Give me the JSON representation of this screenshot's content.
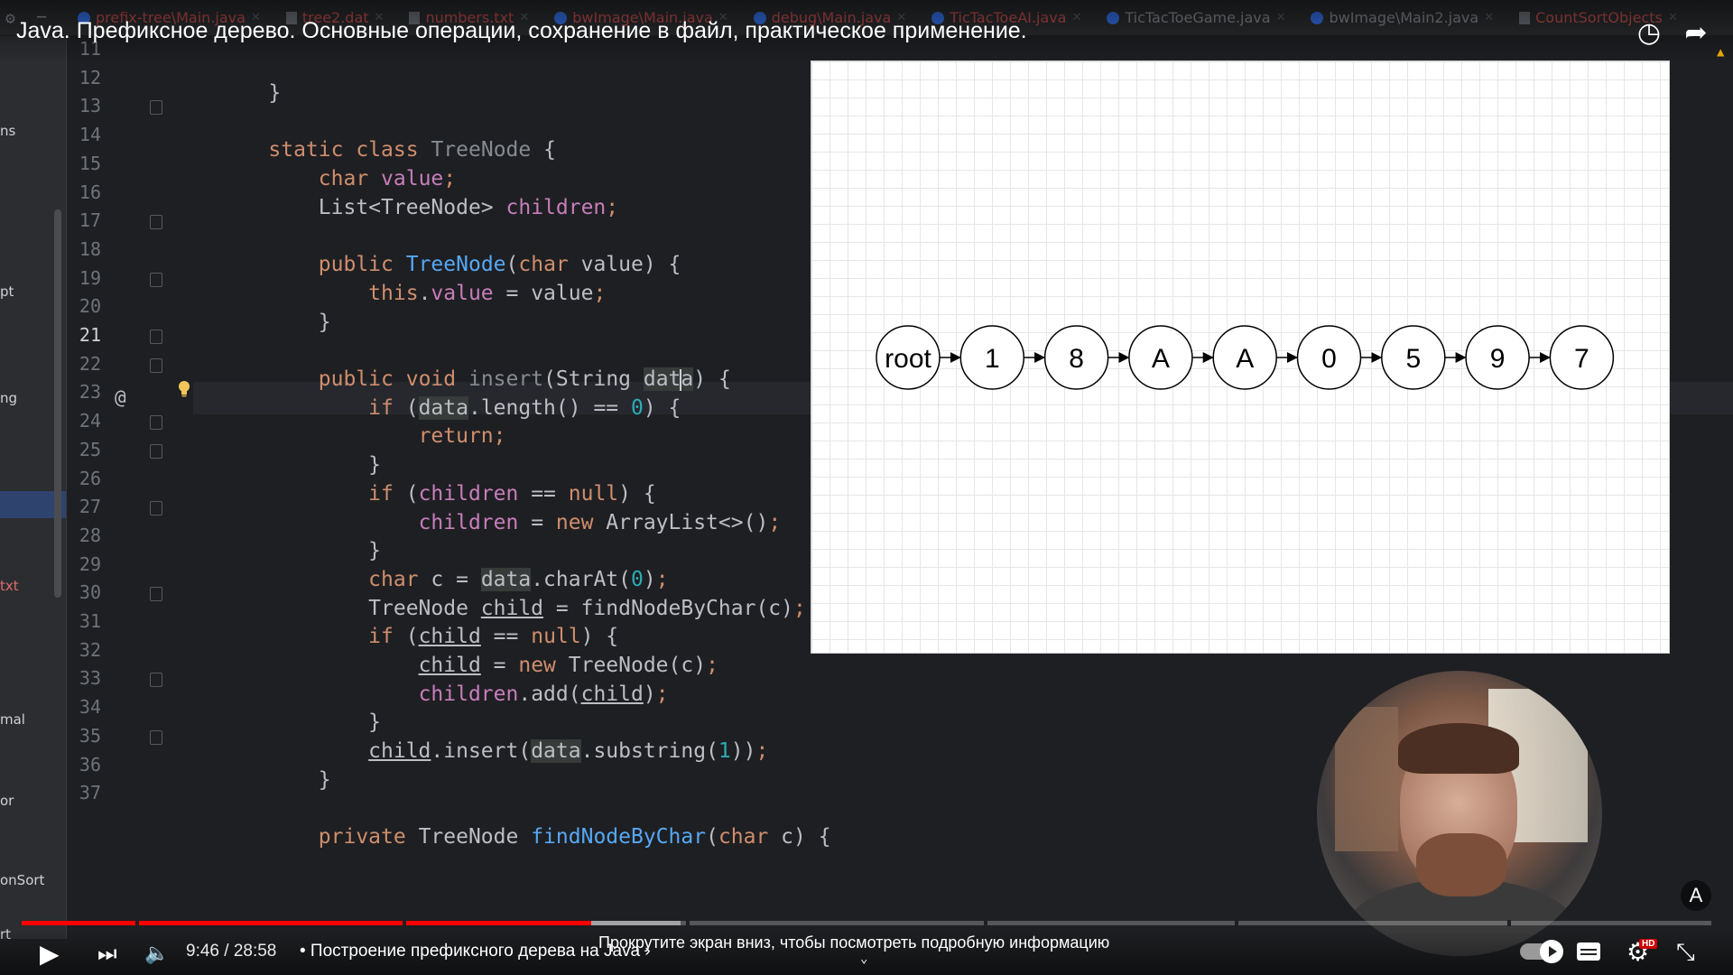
{
  "ide": {
    "tabs": [
      {
        "label": "prefix-tree\\Main.java",
        "kind": "java",
        "color": "red"
      },
      {
        "label": "tree2.dat",
        "kind": "file",
        "color": "red"
      },
      {
        "label": "numbers.txt",
        "kind": "file",
        "color": "red"
      },
      {
        "label": "bwImage\\Main.java",
        "kind": "java",
        "color": "red"
      },
      {
        "label": "debug\\Main.java",
        "kind": "java",
        "color": "red"
      },
      {
        "label": "TicTacToeAI.java",
        "kind": "java",
        "color": "red"
      },
      {
        "label": "TicTacToeGame.java",
        "kind": "java",
        "color": "normal"
      },
      {
        "label": "bwImage\\Main2.java",
        "kind": "java",
        "color": "normal"
      },
      {
        "label": "CountSortObjects",
        "kind": "file",
        "color": "red"
      }
    ],
    "project_fragments": [
      "ns",
      "pt",
      "ng",
      "txt",
      "mal",
      "or",
      "onSort",
      "rt"
    ],
    "line_numbers": [
      "11",
      "12",
      "13",
      "14",
      "15",
      "16",
      "17",
      "18",
      "19",
      "20",
      "21",
      "22",
      "23",
      "24",
      "25",
      "26",
      "27",
      "28",
      "29",
      "30",
      "31",
      "32",
      "33",
      "34",
      "35",
      "36",
      "37"
    ],
    "current_line": "21",
    "code_lines": [
      "    }",
      "",
      "    static class TreeNode {",
      "        char value;",
      "        List<TreeNode> children;",
      "",
      "        public TreeNode(char value) {",
      "            this.value = value;",
      "        }",
      "",
      "        public void insert(String data) {",
      "            if (data.length() == 0) {",
      "                return;",
      "            }",
      "            if (children == null) {",
      "                children = new ArrayList<>();",
      "            }",
      "            char c = data.charAt(0);",
      "            TreeNode child = findNodeByChar(c);",
      "            if (child == null) {",
      "                child = new TreeNode(c);",
      "                children.add(child);",
      "            }",
      "            child.insert(data.substring(1));",
      "        }",
      "",
      "        private TreeNode findNodeByChar(char c) {"
    ]
  },
  "video": {
    "title": "Java. Префиксное дерево. Основные операции, сохранение в файл, практическое применение.",
    "time": "9:46 / 28:58",
    "chapter": "• Построение префиксного дерева на Java ›",
    "scroll_hint": "Прокрутите экран вниз, чтобы посмотреть подробную информацию",
    "hd_label": "HD",
    "translate_label": "A",
    "progress": 0.337,
    "buffered": 0.39,
    "accent": "#ff0000"
  },
  "diagram": {
    "nodes": [
      "root",
      "1",
      "8",
      "A",
      "A",
      "0",
      "5",
      "9",
      "7"
    ]
  }
}
